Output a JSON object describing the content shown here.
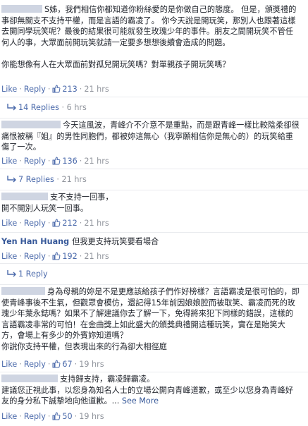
{
  "labels": {
    "like": "Like",
    "reply": "Reply",
    "sep": "·",
    "see_more": "See More"
  },
  "colors": {
    "link_blue": "#365899",
    "meta_gray": "#90949c",
    "divider": "#e9ebee",
    "like_icon": "#4b6aab"
  },
  "comments": [
    {
      "name": "",
      "text": "S姊，我們相信你都知道你粉絲愛的是你做自己的態度。 但是，頒獎禮的事卻無關支不支持平權，而是言語的霸凌了。 你今天說是開玩笑，那別人也跟著這樣去開同學玩笑呢？最後的結果很可能就發生玫瑰少年的事件。朋友之間開玩笑不管任何人的事，大眾面前開玩笑就請一定要多想想後續會造成的問題。\n\n你能想像有人在大眾面前對孤兒開玩笑嗎？對單親孩子開玩笑嗎？",
      "likes": "213",
      "time": "21 hrs",
      "replies": "14 Replies",
      "replies_time": "6 hrs"
    },
    {
      "name": "",
      "text": "今天這風波，青峰介不介意不是重點，而是跟青峰一樣比較陰柔卻很痛恨被稱『姐』的男性同胞們，都被妳這無心（我寧願相信你是無心的）的玩笑給重傷了一次。",
      "likes": "136",
      "time": "21 hrs",
      "replies": "7 Replies",
      "replies_time": "21 hrs"
    },
    {
      "name": "",
      "text": "支不支持一回事，\n開不開別人玩笑一回事。",
      "likes": "212",
      "time": "21 hrs"
    },
    {
      "name": "Yen Han Huang",
      "text": "但我更支持玩笑要看場合",
      "likes": "192",
      "time": "21 hrs",
      "replies": "1 Reply"
    },
    {
      "name": "",
      "text": "身為母親的妳是不是更應該給孩子們作好榜樣？言語霸凌是很可怕的，即使青峰事後不生氣，但觀眾會模仿，還記得15年前因娘娘腔而被取笑、霸凌而死的玫瑰少年葉永鋕嗎？如果不了解建議你去了解一下，免得將來犯下同樣的錯誤，這樣的言語霸凌非常的可怕！在金曲獎上如此盛大的頒獎典禮開這種玩笑，實在是貽笑大方，會場上有多少的外賓妳知道嗎？\n你說你支持平權，但表現出來的行為卻大相徑庭",
      "likes": "67",
      "time": "19 hrs"
    },
    {
      "name": "",
      "text": "支持歸支持，霸凌歸霸凌。\n建議您正視此事，以您身為知名人士的立場公開向青峰道歉，或至少以您身為青峰好友的身分私下誠摯地向他道歉。...",
      "see_more": true,
      "likes": "50",
      "time": "19 hrs"
    }
  ]
}
